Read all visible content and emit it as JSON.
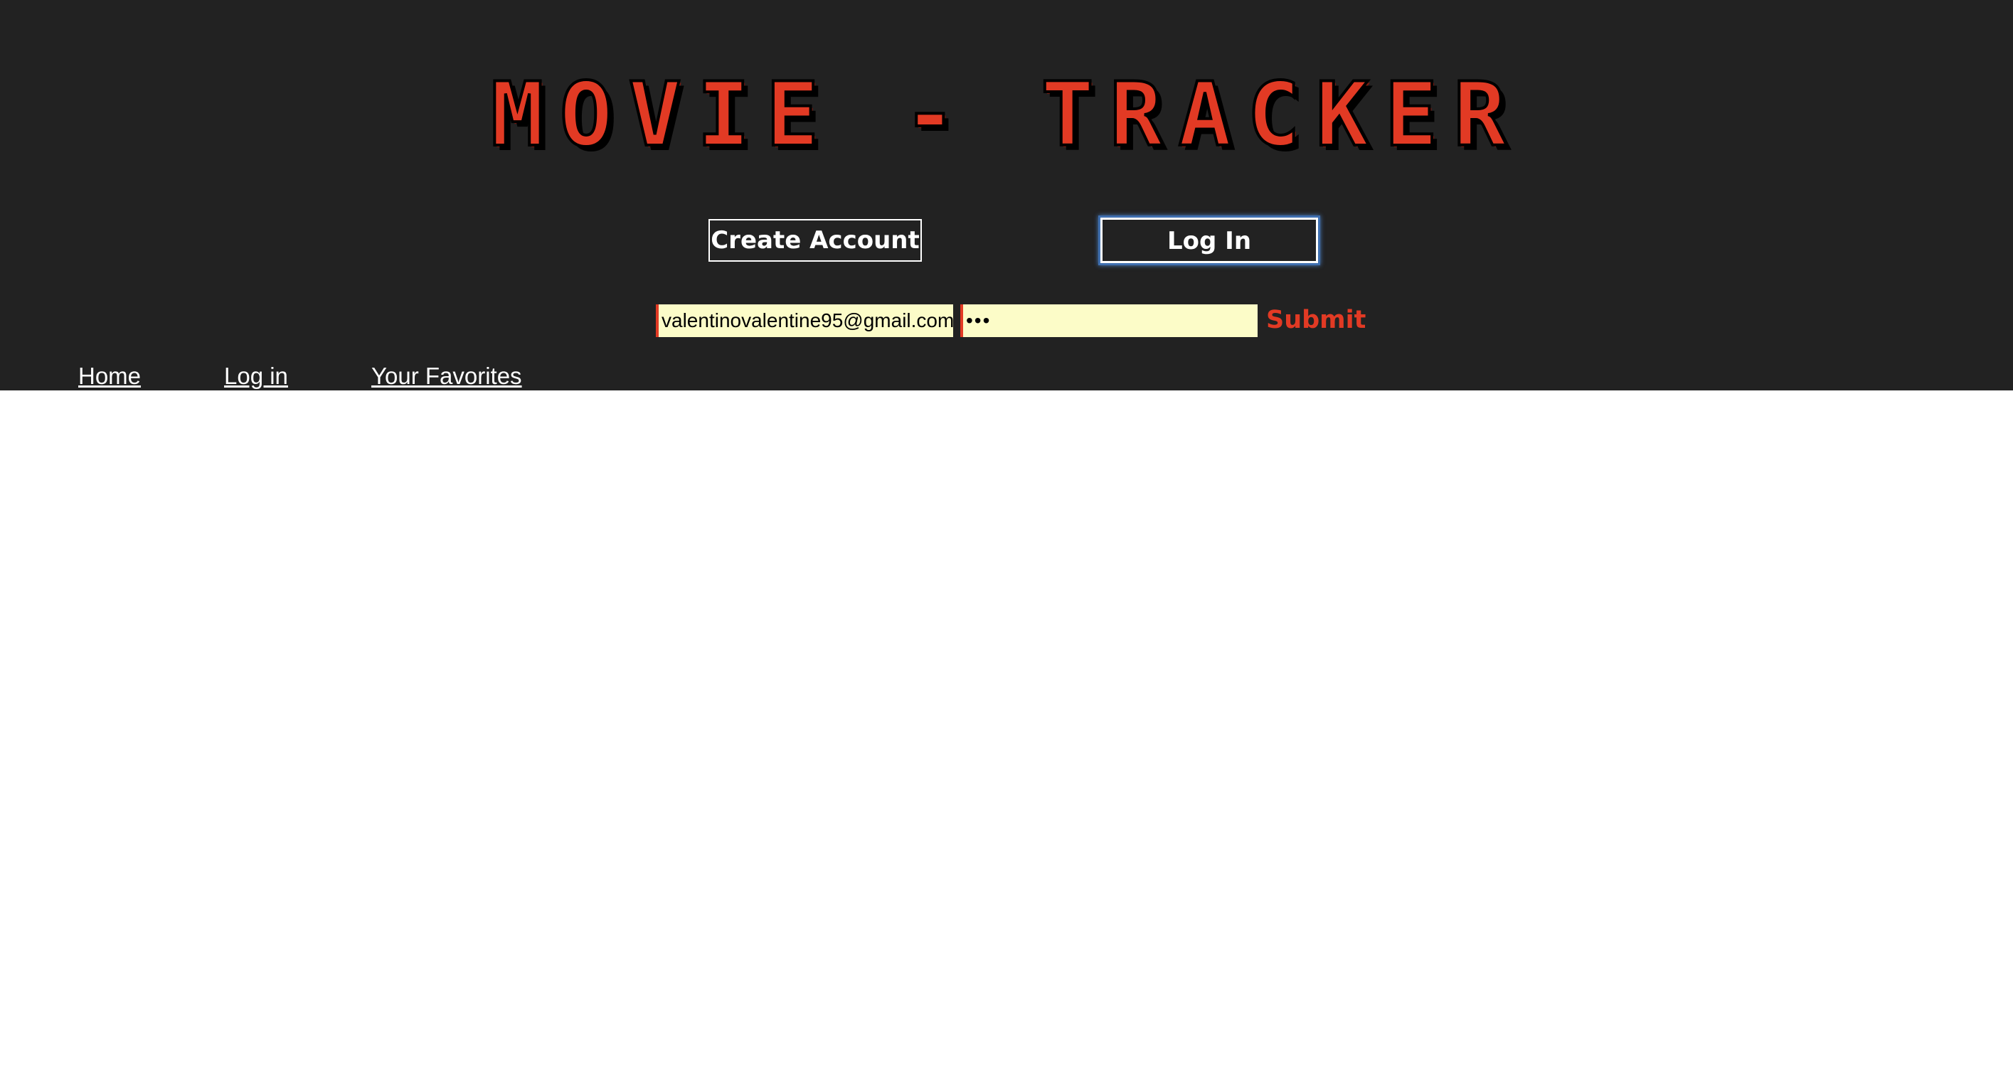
{
  "header": {
    "title": "MOVIE - TRACKER",
    "background_color": "#222222",
    "accent_color": "#e23a24"
  },
  "actions": {
    "create_account_label": "Create Account",
    "log_in_label": "Log In"
  },
  "login_form": {
    "email_value": "valentinovalentine95@gmail.com",
    "password_value": "•••",
    "submit_label": "Submit",
    "field_background": "#fcfcc8"
  },
  "nav": {
    "items": [
      {
        "label": "Home"
      },
      {
        "label": "Log in"
      },
      {
        "label": "Your Favorites"
      }
    ]
  }
}
